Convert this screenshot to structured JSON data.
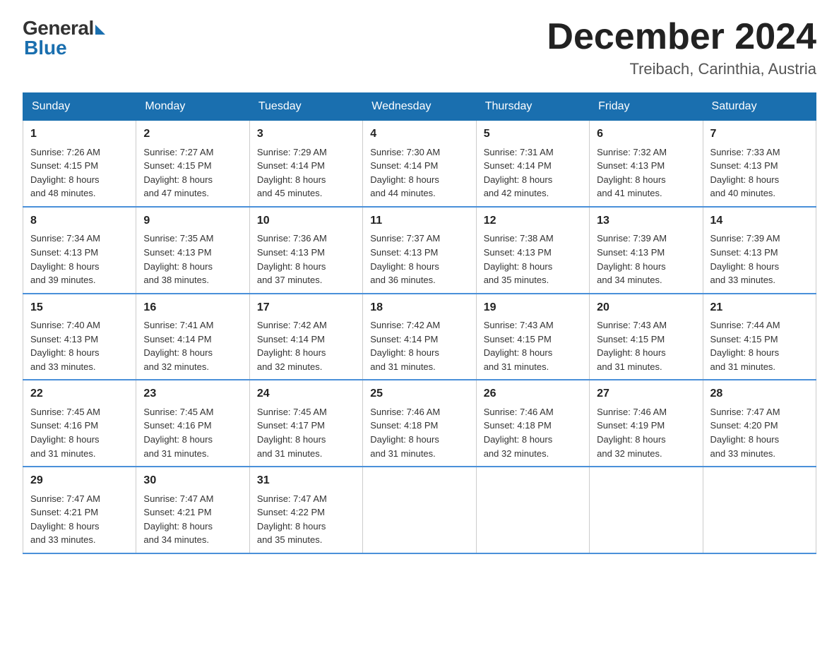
{
  "logo": {
    "general": "General",
    "blue": "Blue"
  },
  "header": {
    "month": "December 2024",
    "location": "Treibach, Carinthia, Austria"
  },
  "days_of_week": [
    "Sunday",
    "Monday",
    "Tuesday",
    "Wednesday",
    "Thursday",
    "Friday",
    "Saturday"
  ],
  "weeks": [
    [
      {
        "day": "1",
        "sunrise": "7:26 AM",
        "sunset": "4:15 PM",
        "daylight": "8 hours and 48 minutes."
      },
      {
        "day": "2",
        "sunrise": "7:27 AM",
        "sunset": "4:15 PM",
        "daylight": "8 hours and 47 minutes."
      },
      {
        "day": "3",
        "sunrise": "7:29 AM",
        "sunset": "4:14 PM",
        "daylight": "8 hours and 45 minutes."
      },
      {
        "day": "4",
        "sunrise": "7:30 AM",
        "sunset": "4:14 PM",
        "daylight": "8 hours and 44 minutes."
      },
      {
        "day": "5",
        "sunrise": "7:31 AM",
        "sunset": "4:14 PM",
        "daylight": "8 hours and 42 minutes."
      },
      {
        "day": "6",
        "sunrise": "7:32 AM",
        "sunset": "4:13 PM",
        "daylight": "8 hours and 41 minutes."
      },
      {
        "day": "7",
        "sunrise": "7:33 AM",
        "sunset": "4:13 PM",
        "daylight": "8 hours and 40 minutes."
      }
    ],
    [
      {
        "day": "8",
        "sunrise": "7:34 AM",
        "sunset": "4:13 PM",
        "daylight": "8 hours and 39 minutes."
      },
      {
        "day": "9",
        "sunrise": "7:35 AM",
        "sunset": "4:13 PM",
        "daylight": "8 hours and 38 minutes."
      },
      {
        "day": "10",
        "sunrise": "7:36 AM",
        "sunset": "4:13 PM",
        "daylight": "8 hours and 37 minutes."
      },
      {
        "day": "11",
        "sunrise": "7:37 AM",
        "sunset": "4:13 PM",
        "daylight": "8 hours and 36 minutes."
      },
      {
        "day": "12",
        "sunrise": "7:38 AM",
        "sunset": "4:13 PM",
        "daylight": "8 hours and 35 minutes."
      },
      {
        "day": "13",
        "sunrise": "7:39 AM",
        "sunset": "4:13 PM",
        "daylight": "8 hours and 34 minutes."
      },
      {
        "day": "14",
        "sunrise": "7:39 AM",
        "sunset": "4:13 PM",
        "daylight": "8 hours and 33 minutes."
      }
    ],
    [
      {
        "day": "15",
        "sunrise": "7:40 AM",
        "sunset": "4:13 PM",
        "daylight": "8 hours and 33 minutes."
      },
      {
        "day": "16",
        "sunrise": "7:41 AM",
        "sunset": "4:14 PM",
        "daylight": "8 hours and 32 minutes."
      },
      {
        "day": "17",
        "sunrise": "7:42 AM",
        "sunset": "4:14 PM",
        "daylight": "8 hours and 32 minutes."
      },
      {
        "day": "18",
        "sunrise": "7:42 AM",
        "sunset": "4:14 PM",
        "daylight": "8 hours and 31 minutes."
      },
      {
        "day": "19",
        "sunrise": "7:43 AM",
        "sunset": "4:15 PM",
        "daylight": "8 hours and 31 minutes."
      },
      {
        "day": "20",
        "sunrise": "7:43 AM",
        "sunset": "4:15 PM",
        "daylight": "8 hours and 31 minutes."
      },
      {
        "day": "21",
        "sunrise": "7:44 AM",
        "sunset": "4:15 PM",
        "daylight": "8 hours and 31 minutes."
      }
    ],
    [
      {
        "day": "22",
        "sunrise": "7:45 AM",
        "sunset": "4:16 PM",
        "daylight": "8 hours and 31 minutes."
      },
      {
        "day": "23",
        "sunrise": "7:45 AM",
        "sunset": "4:16 PM",
        "daylight": "8 hours and 31 minutes."
      },
      {
        "day": "24",
        "sunrise": "7:45 AM",
        "sunset": "4:17 PM",
        "daylight": "8 hours and 31 minutes."
      },
      {
        "day": "25",
        "sunrise": "7:46 AM",
        "sunset": "4:18 PM",
        "daylight": "8 hours and 31 minutes."
      },
      {
        "day": "26",
        "sunrise": "7:46 AM",
        "sunset": "4:18 PM",
        "daylight": "8 hours and 32 minutes."
      },
      {
        "day": "27",
        "sunrise": "7:46 AM",
        "sunset": "4:19 PM",
        "daylight": "8 hours and 32 minutes."
      },
      {
        "day": "28",
        "sunrise": "7:47 AM",
        "sunset": "4:20 PM",
        "daylight": "8 hours and 33 minutes."
      }
    ],
    [
      {
        "day": "29",
        "sunrise": "7:47 AM",
        "sunset": "4:21 PM",
        "daylight": "8 hours and 33 minutes."
      },
      {
        "day": "30",
        "sunrise": "7:47 AM",
        "sunset": "4:21 PM",
        "daylight": "8 hours and 34 minutes."
      },
      {
        "day": "31",
        "sunrise": "7:47 AM",
        "sunset": "4:22 PM",
        "daylight": "8 hours and 35 minutes."
      },
      null,
      null,
      null,
      null
    ]
  ],
  "labels": {
    "sunrise": "Sunrise:",
    "sunset": "Sunset:",
    "daylight": "Daylight:"
  }
}
